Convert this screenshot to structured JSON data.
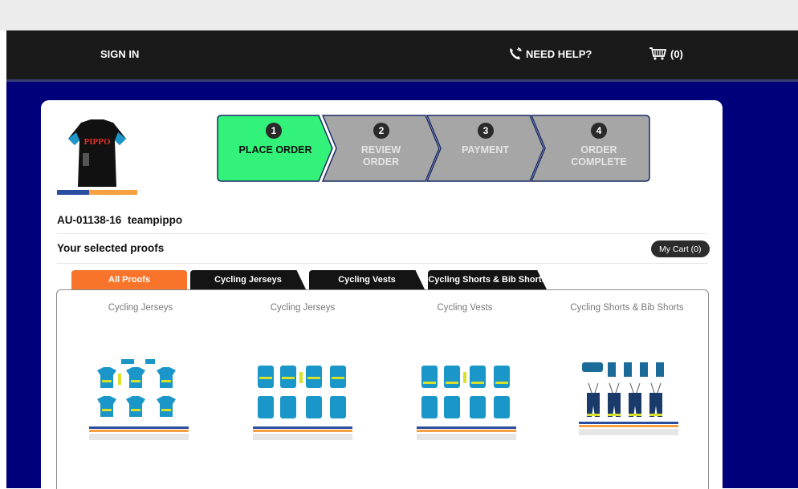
{
  "nav": {
    "sign_in": "SIGN IN",
    "need_help": "NEED HELP?",
    "cart_count": "(0)"
  },
  "steps": [
    {
      "number": "1",
      "label_line1": "PLACE ORDER",
      "label_line2": "",
      "active": true
    },
    {
      "number": "2",
      "label_line1": "REVIEW",
      "label_line2": "ORDER",
      "active": false
    },
    {
      "number": "3",
      "label_line1": "PAYMENT",
      "label_line2": "",
      "active": false
    },
    {
      "number": "4",
      "label_line1": "ORDER",
      "label_line2": "COMPLETE",
      "active": false
    }
  ],
  "thumbnail": {
    "text": "PIPPO"
  },
  "order": {
    "id": "AU-01138-16",
    "team": "teampippo"
  },
  "proofs_section": {
    "title": "Your selected proofs",
    "my_cart": "My Cart (0)"
  },
  "tabs": [
    {
      "label": "All Proofs",
      "active": true
    },
    {
      "label": "Cycling Jerseys",
      "active": false
    },
    {
      "label": "Cycling Vests",
      "active": false
    },
    {
      "label": "Cycling Shorts & Bib Shorts",
      "active": false
    }
  ],
  "proofs": [
    {
      "caption": "Cycling Jerseys"
    },
    {
      "caption": "Cycling Jerseys"
    },
    {
      "caption": "Cycling Vests"
    },
    {
      "caption": "Cycling Shorts & Bib Shorts"
    }
  ],
  "colors": {
    "active_step": "#33f27a",
    "inactive_step": "#a6a6a6",
    "step_border": "#1c2a66",
    "navy_background": "#00007a",
    "active_tab": "#f7742a",
    "jersey_blue": "#1a96c8",
    "jersey_yellow": "#d8e02a"
  }
}
